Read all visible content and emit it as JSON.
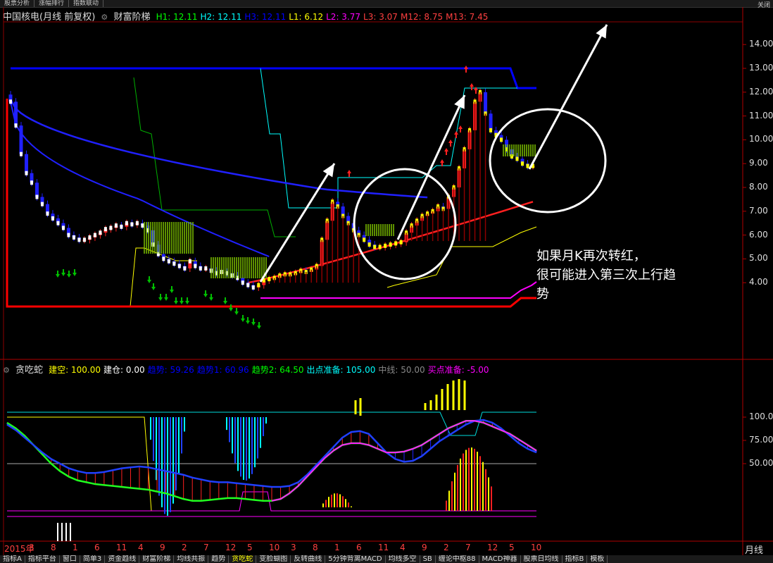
{
  "topbar": {
    "tabs": [
      "股票分析",
      "涨幅排行",
      "指数联动"
    ],
    "close_label": "关闭"
  },
  "main_header": {
    "stock": "中国核电(月线 前复权)",
    "indicator": "财富阶梯",
    "items": [
      {
        "label": "H1: 12.11",
        "color": "#00ff00"
      },
      {
        "label": "H2: 12.11",
        "color": "#00ffff"
      },
      {
        "label": "H3: 12.11",
        "color": "#0000ff"
      },
      {
        "label": "L1: 6.12",
        "color": "#ffff00"
      },
      {
        "label": "L2: 3.77",
        "color": "#ff00ff"
      },
      {
        "label": "L3: 3.07",
        "color": "#ff4040"
      },
      {
        "label": "M12: 8.75",
        "color": "#ff4040"
      },
      {
        "label": "M13: 7.45",
        "color": "#ff4040"
      }
    ]
  },
  "sub_header": {
    "indicator": "贪吃蛇",
    "items": [
      {
        "label": "建空: 100.00",
        "color": "#ffff00"
      },
      {
        "label": "建仓: 0.00",
        "color": "#ffffff"
      },
      {
        "label": "趋势: 59.26",
        "color": "#0000ff"
      },
      {
        "label": "趋势1: 60.96",
        "color": "#0000ff"
      },
      {
        "label": "趋势2: 64.50",
        "color": "#00ff00"
      },
      {
        "label": "出点准备: 105.00",
        "color": "#00ffff"
      },
      {
        "label": "中线: 50.00",
        "color": "#888888"
      },
      {
        "label": "买点准备: -5.00",
        "color": "#ff00ff"
      }
    ]
  },
  "annotation": {
    "line1": "如果月K再次转红，",
    "line2": "很可能进入第三次上行趋",
    "line3": "势"
  },
  "x_axis_labels": [
    "2015年",
    "3",
    "8",
    "1",
    "6",
    "11",
    "4",
    "9",
    "2",
    "7",
    "12",
    "5",
    "10",
    "3",
    "8",
    "1",
    "6",
    "11",
    "4",
    "9",
    "2",
    "7",
    "12",
    "5",
    "10"
  ],
  "period_label": "月线",
  "tabbar": {
    "items": [
      "指标A",
      "指标平台",
      "窗口",
      "简单3",
      "资金趋线",
      "财富阶梯",
      "均线共振",
      "趋势",
      "贪吃蛇",
      "变脸蝴图",
      "反转曲线",
      "5分钟背离MACD",
      "均线多空",
      "SB",
      "缠论中枢88",
      "MACD神器",
      "股票日均线",
      "指标B",
      "模板"
    ],
    "active": "贪吃蛇"
  },
  "chart_data": [
    {
      "type": "candlestick",
      "title": "中国核电(月线 前复权)",
      "ylim": [
        3.0,
        15.0
      ],
      "yticks": [
        4.0,
        5.0,
        6.0,
        7.0,
        8.0,
        9.0,
        10.0,
        11.0,
        12.0,
        13.0,
        14.0
      ],
      "ytick_labels": [
        "4.00",
        "5.00",
        "6.00",
        "7.00",
        "8.00",
        "9.00",
        "10.00",
        "11.00",
        "12.00",
        "13.00",
        "14.00"
      ],
      "close": [
        11.6,
        10.6,
        9.4,
        8.6,
        8.2,
        7.6,
        7.3,
        6.9,
        6.7,
        6.5,
        6.3,
        6.0,
        5.9,
        5.8,
        5.8,
        5.9,
        6.0,
        6.1,
        6.25,
        6.3,
        6.4,
        6.35,
        6.5,
        6.45,
        6.5,
        6.4,
        6.2,
        5.6,
        5.2,
        5.0,
        4.9,
        4.8,
        4.7,
        4.6,
        4.9,
        4.7,
        4.6,
        4.6,
        4.5,
        4.4,
        4.45,
        4.4,
        4.3,
        4.2,
        4.0,
        3.9,
        3.8,
        3.9,
        4.1,
        4.15,
        4.2,
        4.3,
        4.35,
        4.35,
        4.4,
        4.5,
        4.45,
        4.55,
        4.7,
        5.8,
        6.6,
        7.4,
        7.2,
        6.8,
        6.5,
        6.2,
        6.0,
        5.8,
        5.6,
        5.5,
        5.5,
        5.55,
        5.6,
        5.65,
        5.7,
        6.1,
        6.4,
        6.6,
        6.8,
        6.9,
        7.0,
        7.2,
        7.1,
        7.6,
        8.0,
        8.8,
        9.6,
        10.4,
        11.6,
        12.0,
        11.1,
        10.4,
        10.2,
        10.0,
        9.6,
        9.3,
        9.2,
        9.0,
        8.9,
        8.9
      ],
      "ma_values": {
        "M12": 8.75,
        "M13": 7.45,
        "H1": 12.11,
        "L1": 6.12,
        "L2": 3.77,
        "L3": 3.07
      }
    },
    {
      "type": "line",
      "title": "贪吃蛇",
      "ylim": [
        -5,
        130
      ],
      "yticks": [
        50,
        75,
        100
      ],
      "ytick_labels": [
        "50.00",
        "75.00",
        "100.0"
      ],
      "series": [
        {
          "name": "趋势",
          "values": [
            92,
            86,
            78,
            70,
            62,
            55,
            50,
            45,
            42,
            40,
            40,
            41,
            43,
            45,
            46,
            47,
            46,
            44,
            42,
            40,
            38,
            35,
            33,
            31,
            30,
            30,
            29,
            28,
            27,
            26,
            25,
            25,
            26,
            30,
            38,
            48,
            58,
            68,
            78,
            84,
            85,
            82,
            72,
            62,
            55,
            52,
            53,
            58,
            66,
            74,
            80,
            86,
            92,
            96,
            97,
            94,
            88,
            80,
            72,
            66,
            62
          ]
        },
        {
          "name": "趋势2",
          "values": [
            94,
            88,
            80,
            70,
            60,
            50,
            42,
            36,
            32,
            30,
            28,
            27,
            26,
            25,
            24,
            23,
            22,
            20,
            18,
            15,
            12,
            10,
            10,
            11,
            12,
            13,
            13,
            12,
            11,
            10,
            10,
            12,
            18,
            26,
            36,
            46,
            56,
            64,
            70,
            72,
            72,
            70,
            66,
            62,
            62,
            63,
            66,
            70,
            76,
            82,
            88,
            92,
            96,
            96,
            94,
            90,
            86,
            82,
            76,
            70,
            64
          ]
        }
      ]
    }
  ]
}
